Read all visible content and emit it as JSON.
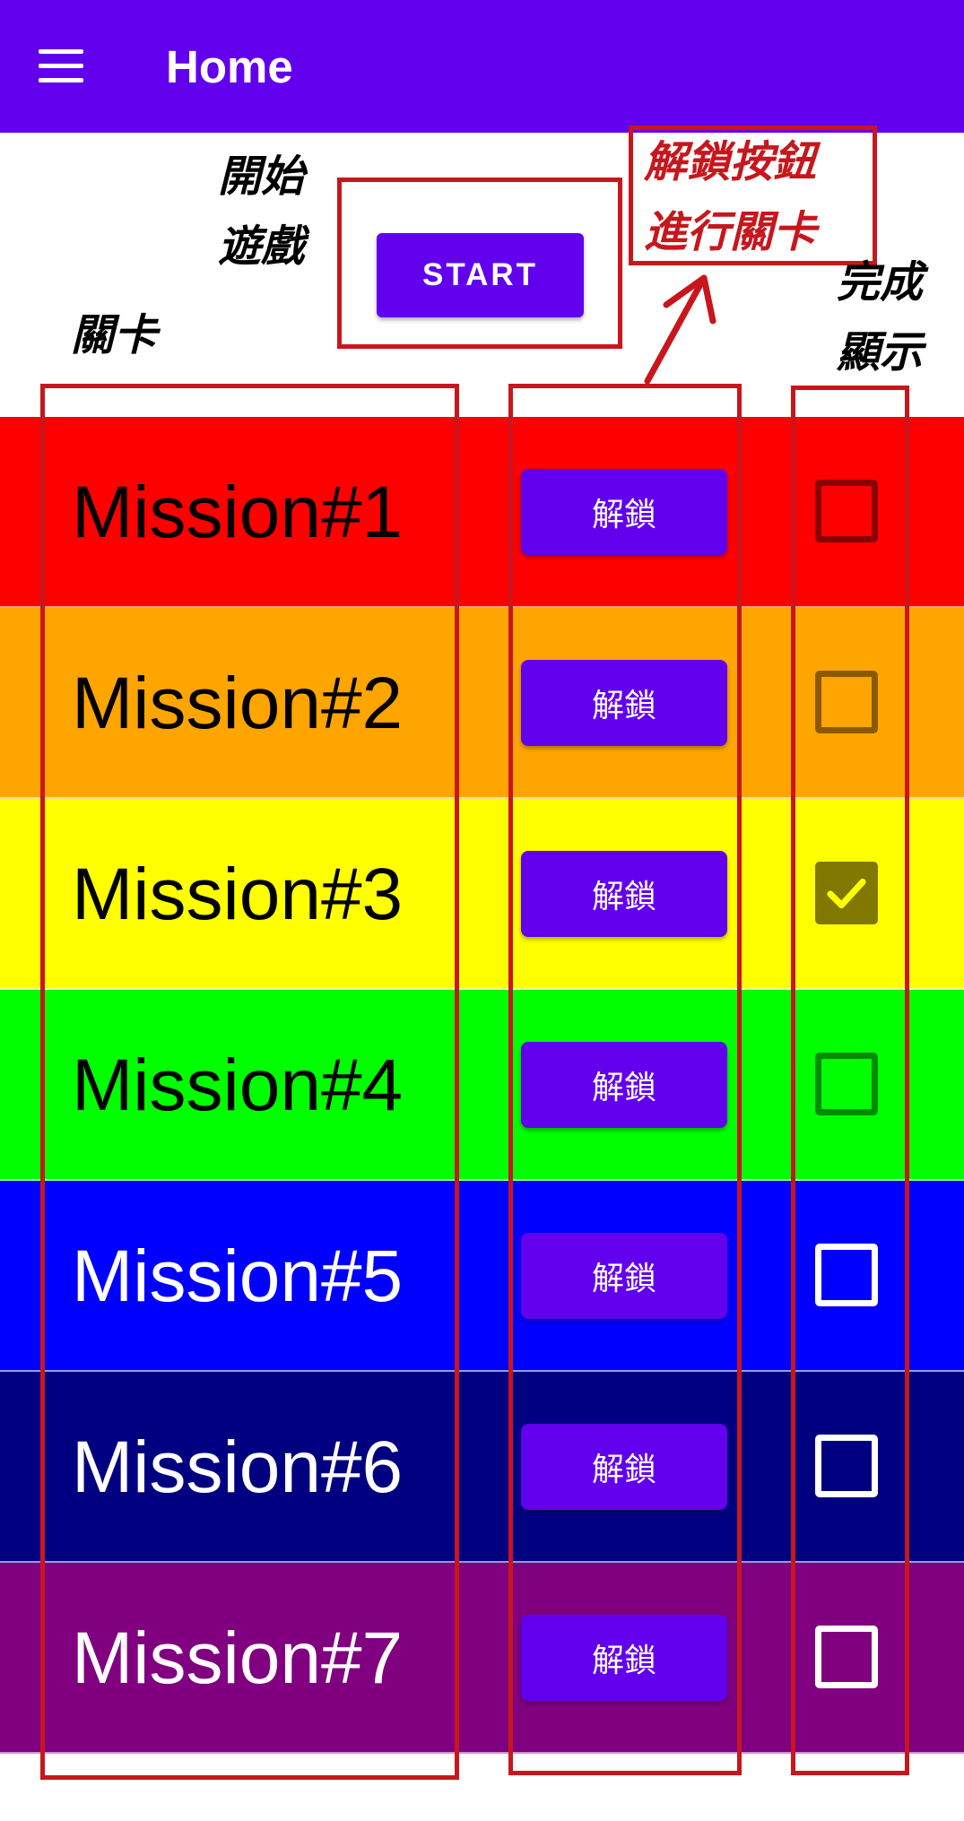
{
  "appbar": {
    "title": "Home",
    "menu_icon": "hamburger-menu-icon",
    "color": "#6200ee"
  },
  "start_button": {
    "label": "START"
  },
  "annotations": {
    "start_game": "開始\n遊戲",
    "unlock_hint": "解鎖按鈕\n進行關卡",
    "levels": "關卡",
    "completed": "完成\n顯示"
  },
  "annotation_color": "#c8161d",
  "missions": [
    {
      "label": "Mission#1",
      "unlock_label": "解鎖",
      "checked": false,
      "bg": "#ff0000",
      "text_color": "#000000",
      "checkbox_color": "#8b0000"
    },
    {
      "label": "Mission#2",
      "unlock_label": "解鎖",
      "checked": false,
      "bg": "#ffa500",
      "text_color": "#000000",
      "checkbox_color": "#8b5a00"
    },
    {
      "label": "Mission#3",
      "unlock_label": "解鎖",
      "checked": true,
      "bg": "#ffff00",
      "text_color": "#000000",
      "checkbox_color": "#807800"
    },
    {
      "label": "Mission#4",
      "unlock_label": "解鎖",
      "checked": false,
      "bg": "#00ff00",
      "text_color": "#000000",
      "checkbox_color": "#008b00"
    },
    {
      "label": "Mission#5",
      "unlock_label": "解鎖",
      "checked": false,
      "bg": "#0000ff",
      "text_color": "#ffffff",
      "checkbox_color": "#ffffff"
    },
    {
      "label": "Mission#6",
      "unlock_label": "解鎖",
      "checked": false,
      "bg": "#000080",
      "text_color": "#ffffff",
      "checkbox_color": "#ffffff"
    },
    {
      "label": "Mission#7",
      "unlock_label": "解鎖",
      "checked": false,
      "bg": "#800080",
      "text_color": "#ffffff",
      "checkbox_color": "#ffffff"
    }
  ]
}
